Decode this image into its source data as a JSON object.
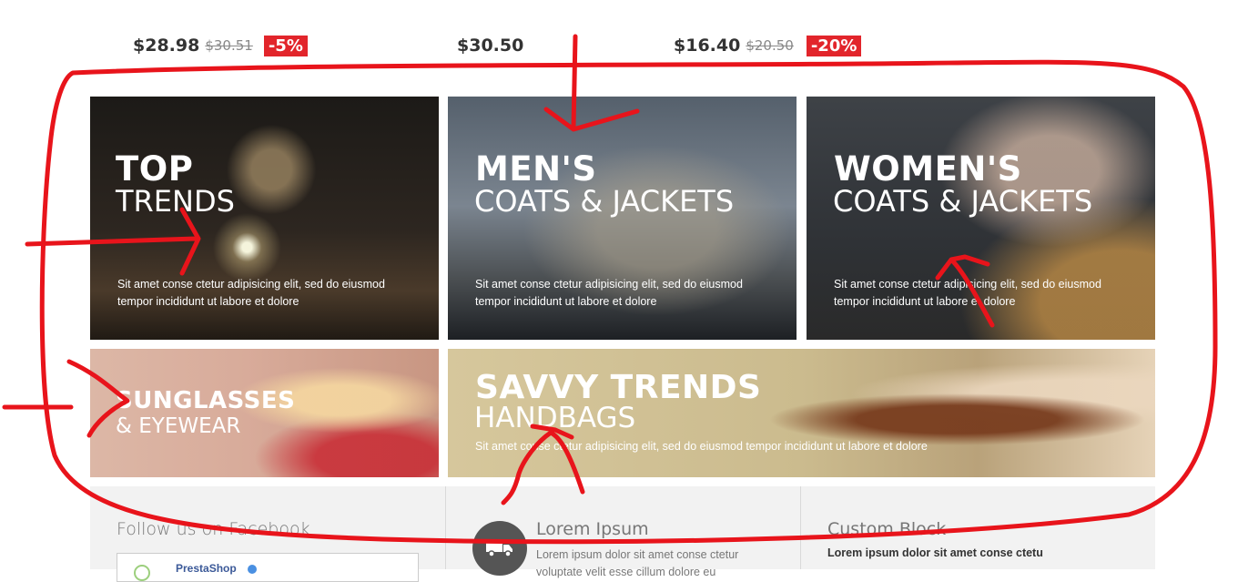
{
  "products": [
    {
      "price": "$28.98",
      "old_price": "$30.51",
      "discount": "-5%"
    },
    {
      "price": "$30.50"
    },
    {
      "price": "$16.40",
      "old_price": "$20.50",
      "discount": "-20%"
    }
  ],
  "banners": [
    {
      "title_bold": "TOP",
      "title_light": "TRENDS",
      "description_line1": "Sit amet conse ctetur adipisicing elit, sed do eiusmod",
      "description_line2": "tempor incididunt ut labore et dolore"
    },
    {
      "title_bold": "MEN'S",
      "title_light": "COATS & JACKETS",
      "description_line1": "Sit amet conse ctetur adipisicing elit, sed do eiusmod",
      "description_line2": "tempor incididunt ut labore et dolore"
    },
    {
      "title_bold": "WOMEN'S",
      "title_light": "COATS & JACKETS",
      "description_line1": "Sit amet conse ctetur adipisicing elit, sed do eiusmod",
      "description_line2": "tempor incididunt ut labore et dolore"
    },
    {
      "title_bold": "SUNGLASSES",
      "title_light": "& EYEWEAR"
    },
    {
      "title_bold": "SAVVY TRENDS",
      "title_light": "HANDBAGS",
      "description_line1": "Sit amet conse ctetur adipisicing elit, sed do eiusmod tempor incididunt ut labore et dolore"
    }
  ],
  "footer": {
    "facebook": {
      "title": "Follow us on Facebook",
      "page_name": "PrestaShop"
    },
    "lorem": {
      "title": "Lorem Ipsum",
      "text_line1": "Lorem ipsum dolor sit amet conse ctetur",
      "text_line2": "voluptate velit esse cillum dolore eu"
    },
    "custom": {
      "title": "Custom Block",
      "text": "Lorem ipsum dolor sit amet conse ctetu"
    }
  },
  "colors": {
    "annotation": "#e8141b",
    "discount_badge": "#e2252b"
  }
}
